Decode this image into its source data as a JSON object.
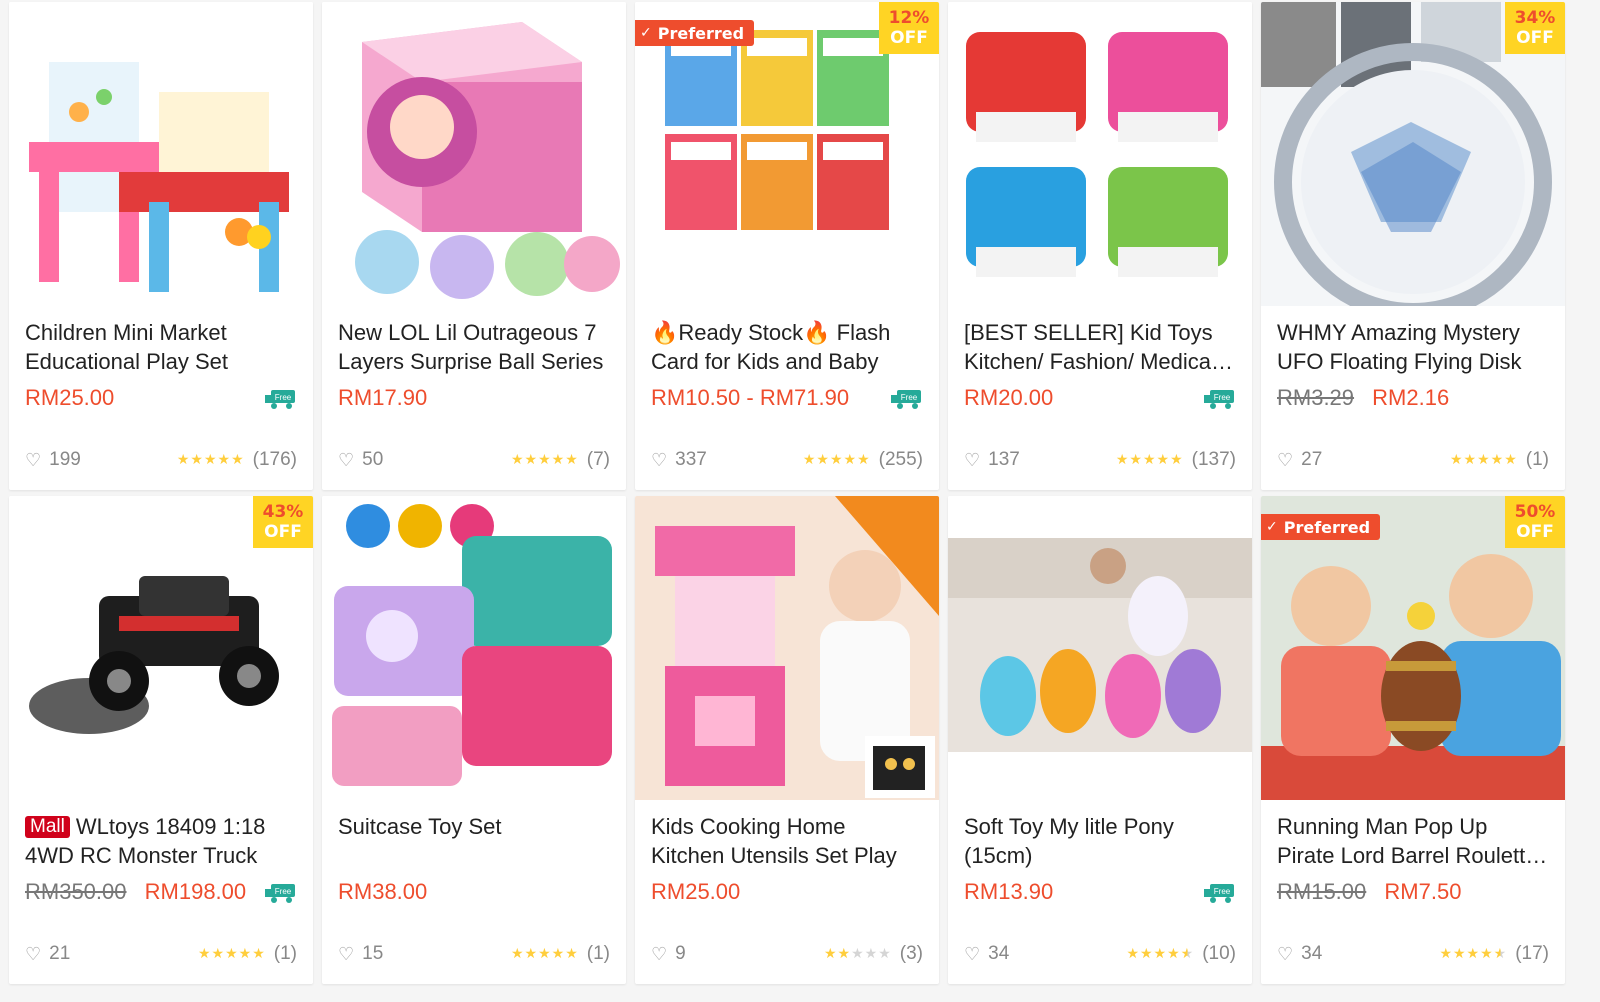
{
  "colors": {
    "accent": "#ee4d2d",
    "star": "#ffce3d",
    "discount_bg": "#ffd424",
    "free_ship": "#26aa99"
  },
  "free_label": "Free",
  "off_label": "OFF",
  "preferred_label": "Preferred",
  "mall_label": "Mall",
  "products": [
    {
      "title": "Children Mini Market Educational Play Set",
      "price": "RM25.00",
      "likes": "199",
      "rating": 5,
      "reviews": "(176)"
    },
    {
      "title": "New LOL Lil Outrageous 7 Layers Surprise Ball Series",
      "price": "RM17.90",
      "likes": "50",
      "rating": 5,
      "reviews": "(7)"
    },
    {
      "title": "🔥Ready Stock🔥 Flash Card for Kids and Baby",
      "price": "RM10.50 - RM71.90",
      "likes": "337",
      "rating": 5,
      "reviews": "(255)",
      "discount": "12%"
    },
    {
      "title": "[BEST SELLER] Kid Toys Kitchen/ Fashion/ Medical/ BBQ",
      "price": "RM20.00",
      "likes": "137",
      "rating": 5,
      "reviews": "(137)"
    },
    {
      "title": "WHMY Amazing Mystery UFO Floating Flying Disk",
      "old_price": "RM3.29",
      "price": "RM2.16",
      "likes": "27",
      "rating": 5,
      "reviews": "(1)",
      "discount": "34%"
    },
    {
      "title": "WLtoys 18409 1:18 4WD RC Monster Truck",
      "old_price": "RM350.00",
      "price": "RM198.00",
      "likes": "21",
      "rating": 5,
      "reviews": "(1)",
      "discount": "43%"
    },
    {
      "title": "Suitcase Toy Set",
      "price": "RM38.00",
      "likes": "15",
      "rating": 5,
      "reviews": "(1)"
    },
    {
      "title": "Kids Cooking Home Kitchen Utensils Set Play",
      "price": "RM25.00",
      "likes": "9",
      "rating": 2,
      "reviews": "(3)"
    },
    {
      "title": "Soft Toy My litle Pony (15cm)",
      "price": "RM13.90",
      "likes": "34",
      "rating": 4.5,
      "reviews": "(10)"
    },
    {
      "title": "Running Man Pop Up Pirate Lord Barrel Roulette Game",
      "old_price": "RM15.00",
      "price": "RM7.50",
      "likes": "34",
      "rating": 4.5,
      "reviews": "(17)",
      "discount": "50%"
    }
  ]
}
